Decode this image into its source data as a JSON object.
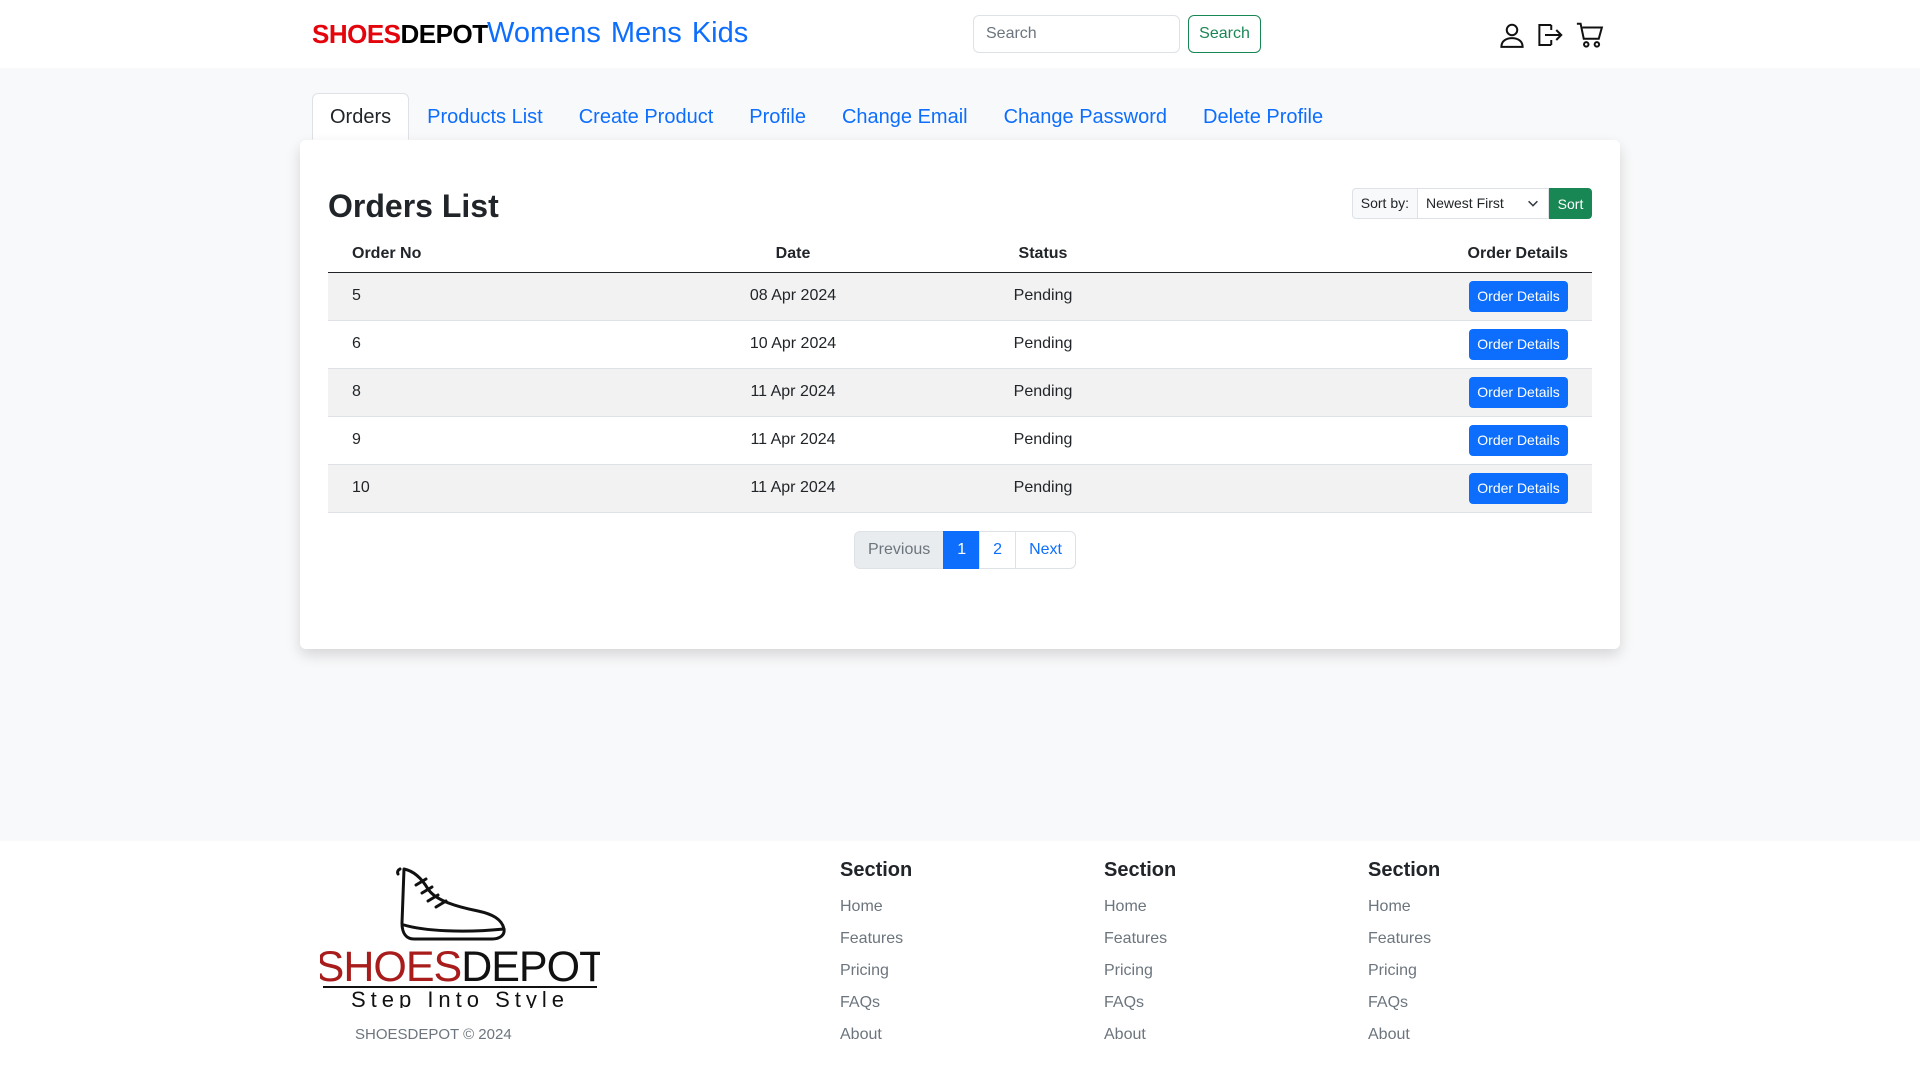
{
  "header": {
    "brand_part1": "SHOES",
    "brand_part2": "DEPOT",
    "nav": [
      "Womens",
      "Mens",
      "Kids"
    ],
    "search_placeholder": "Search",
    "search_button": "Search",
    "icons": [
      "user-icon",
      "logout-icon",
      "cart-icon"
    ]
  },
  "tabs": [
    {
      "label": "Orders",
      "active": true
    },
    {
      "label": "Products List",
      "active": false
    },
    {
      "label": "Create Product",
      "active": false
    },
    {
      "label": "Profile",
      "active": false
    },
    {
      "label": "Change Email",
      "active": false
    },
    {
      "label": "Change Password",
      "active": false
    },
    {
      "label": "Delete Profile",
      "active": false
    }
  ],
  "orders": {
    "title": "Orders List",
    "sort": {
      "label": "Sort by:",
      "selected": "Newest First",
      "button": "Sort"
    },
    "columns": [
      "Order No",
      "Date",
      "Status",
      "Order Details"
    ],
    "rows": [
      {
        "order_no": "5",
        "date": "08 Apr 2024",
        "status": "Pending",
        "action": "Order Details"
      },
      {
        "order_no": "6",
        "date": "10 Apr 2024",
        "status": "Pending",
        "action": "Order Details"
      },
      {
        "order_no": "8",
        "date": "11 Apr 2024",
        "status": "Pending",
        "action": "Order Details"
      },
      {
        "order_no": "9",
        "date": "11 Apr 2024",
        "status": "Pending",
        "action": "Order Details"
      },
      {
        "order_no": "10",
        "date": "11 Apr 2024",
        "status": "Pending",
        "action": "Order Details"
      }
    ],
    "pagination": {
      "previous": "Previous",
      "pages": [
        "1",
        "2"
      ],
      "current": "1",
      "next": "Next"
    }
  },
  "footer": {
    "logo_text_1": "SHOES",
    "logo_text_2": "DEPOT",
    "logo_tagline": "Step Into Style",
    "copyright": "SHOESDEPOT © 2024",
    "columns": [
      {
        "heading": "Section",
        "links": [
          "Home",
          "Features",
          "Pricing",
          "FAQs",
          "About"
        ]
      },
      {
        "heading": "Section",
        "links": [
          "Home",
          "Features",
          "Pricing",
          "FAQs",
          "About"
        ]
      },
      {
        "heading": "Section",
        "links": [
          "Home",
          "Features",
          "Pricing",
          "FAQs",
          "About"
        ]
      }
    ]
  },
  "colors": {
    "brand_red": "#e4040c",
    "logo_red": "#a81c1c",
    "primary": "#0d6efd",
    "success": "#198754",
    "page_bg": "#f8f9fa"
  }
}
